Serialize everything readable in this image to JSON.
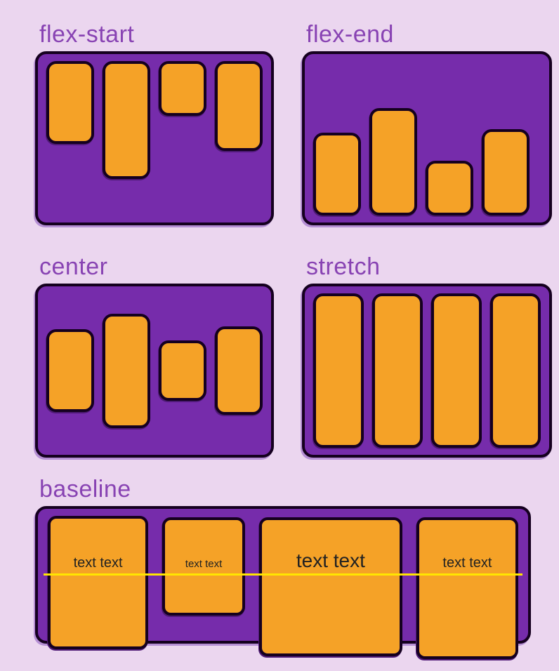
{
  "labels": {
    "flex_start": "flex-start",
    "flex_end": "flex-end",
    "center": "center",
    "stretch": "stretch",
    "baseline": "baseline"
  },
  "baseline_text": {
    "item1": "text text",
    "item2": "text text",
    "item3": "text text",
    "item4": "text text"
  },
  "colors": {
    "background": "#ebd6ef",
    "container": "#762cab",
    "item": "#f5a227",
    "label": "#8843b3",
    "baseline_line": "#ffe600",
    "stroke": "#15001f"
  }
}
